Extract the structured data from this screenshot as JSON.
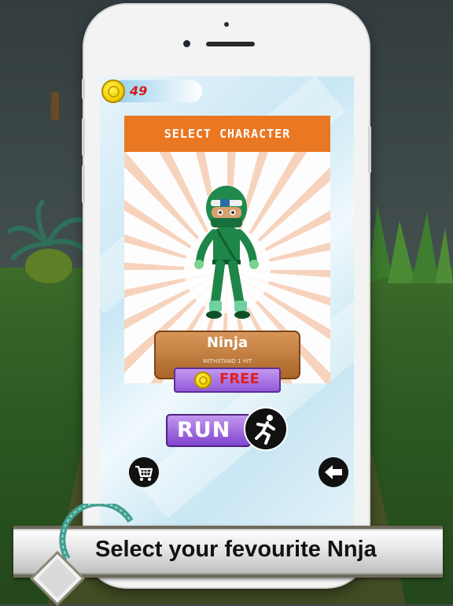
{
  "hud": {
    "coins": "49"
  },
  "panel": {
    "title": "SELECT CHARACTER"
  },
  "character": {
    "name": "Ninja",
    "ability": "WITHSTAND 1 HIT",
    "price": "FREE"
  },
  "buttons": {
    "run": "RUN"
  },
  "icons": {
    "coin": "coin-icon",
    "cart": "shopping-cart-icon",
    "back": "arrow-left-icon",
    "runner": "running-man-icon"
  },
  "caption": "Select your fevourite Nnja",
  "colors": {
    "header": "#ea7722",
    "button_purple": "#8f55d8",
    "price_text": "#e11f1f",
    "nameplate": "#a96326"
  }
}
